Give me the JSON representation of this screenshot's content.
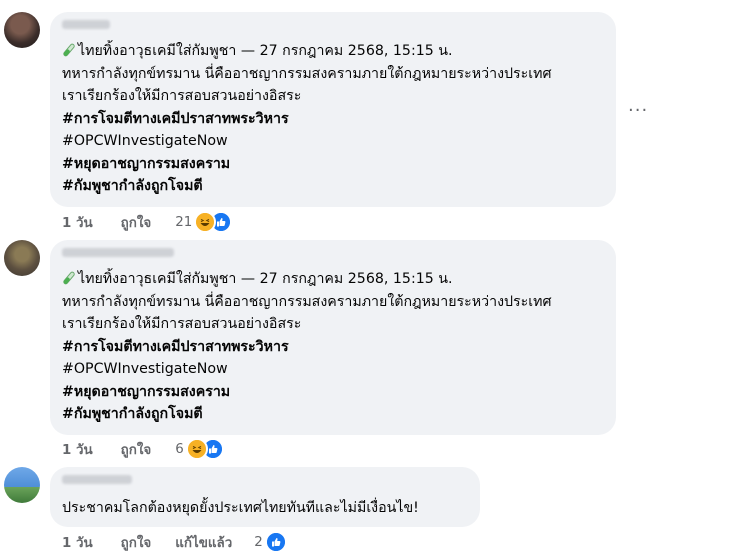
{
  "comments": [
    {
      "lines": [
        "ไทยทิ้งอาวุธเคมีใส่กัมพูชา — 27 กรกฎาคม 2568, 15:15 น.",
        "ทหารกำลังทุกข์ทรมาน นี่คืออาชญากรรมสงครามภายใต้กฎหมายระหว่างประเทศ",
        "เราเรียกร้องให้มีการสอบสวนอย่างอิสระ"
      ],
      "hashtags": [
        "#การโจมตีทางเคมีปราสาทพระวิหาร",
        "#OPCWInvestigateNow",
        "#หยุดอาชญากรรมสงคราม",
        "#กัมพูชากำลังถูกโจมตี"
      ],
      "time": "1 วัน",
      "like": "ถูกใจ",
      "reaction_count": "21",
      "reactions": [
        "haha-icon",
        "like-icon"
      ]
    },
    {
      "lines": [
        "ไทยทิ้งอาวุธเคมีใส่กัมพูชา — 27 กรกฎาคม 2568, 15:15 น.",
        "ทหารกำลังทุกข์ทรมาน นี่คืออาชญากรรมสงครามภายใต้กฎหมายระหว่างประเทศ",
        "เราเรียกร้องให้มีการสอบสวนอย่างอิสระ"
      ],
      "hashtags": [
        "#การโจมตีทางเคมีปราสาทพระวิหาร",
        "#OPCWInvestigateNow",
        "#หยุดอาชญากรรมสงคราม",
        "#กัมพูชากำลังถูกโจมตี"
      ],
      "time": "1 วัน",
      "like": "ถูกใจ",
      "reaction_count": "6",
      "reactions": [
        "haha-icon",
        "like-icon"
      ]
    },
    {
      "lines": [
        "ประชาคมโลกต้องหยุดยั้งประเทศไทยทันทีและไม่มีเงื่อนไข!"
      ],
      "time": "1 วัน",
      "like": "ถูกใจ",
      "edited": "แก้ไขแล้ว",
      "reaction_count": "2",
      "reactions": [
        "like-icon"
      ]
    }
  ],
  "more_label": "···",
  "colors": {
    "bubble": "#f0f2f5",
    "meta": "#65676b",
    "like": "#1877f2",
    "haha": "#f7b125"
  }
}
